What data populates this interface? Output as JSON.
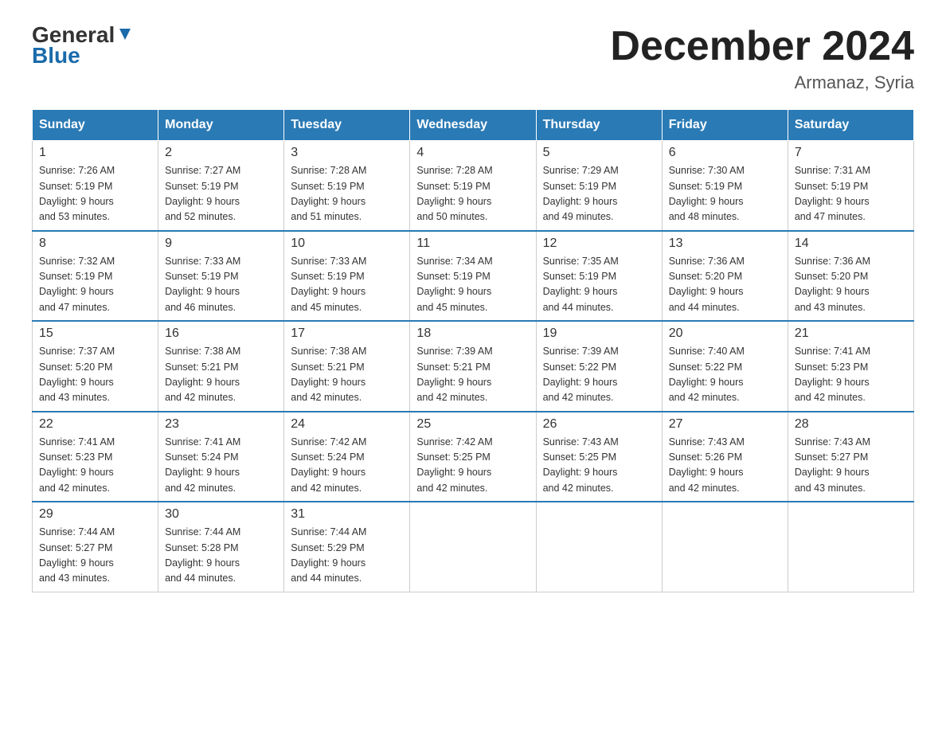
{
  "logo": {
    "line1": "General",
    "line2": "Blue"
  },
  "title": "December 2024",
  "subtitle": "Armanaz, Syria",
  "weekdays": [
    "Sunday",
    "Monday",
    "Tuesday",
    "Wednesday",
    "Thursday",
    "Friday",
    "Saturday"
  ],
  "weeks": [
    [
      {
        "day": "1",
        "sunrise": "7:26 AM",
        "sunset": "5:19 PM",
        "daylight": "9 hours and 53 minutes."
      },
      {
        "day": "2",
        "sunrise": "7:27 AM",
        "sunset": "5:19 PM",
        "daylight": "9 hours and 52 minutes."
      },
      {
        "day": "3",
        "sunrise": "7:28 AM",
        "sunset": "5:19 PM",
        "daylight": "9 hours and 51 minutes."
      },
      {
        "day": "4",
        "sunrise": "7:28 AM",
        "sunset": "5:19 PM",
        "daylight": "9 hours and 50 minutes."
      },
      {
        "day": "5",
        "sunrise": "7:29 AM",
        "sunset": "5:19 PM",
        "daylight": "9 hours and 49 minutes."
      },
      {
        "day": "6",
        "sunrise": "7:30 AM",
        "sunset": "5:19 PM",
        "daylight": "9 hours and 48 minutes."
      },
      {
        "day": "7",
        "sunrise": "7:31 AM",
        "sunset": "5:19 PM",
        "daylight": "9 hours and 47 minutes."
      }
    ],
    [
      {
        "day": "8",
        "sunrise": "7:32 AM",
        "sunset": "5:19 PM",
        "daylight": "9 hours and 47 minutes."
      },
      {
        "day": "9",
        "sunrise": "7:33 AM",
        "sunset": "5:19 PM",
        "daylight": "9 hours and 46 minutes."
      },
      {
        "day": "10",
        "sunrise": "7:33 AM",
        "sunset": "5:19 PM",
        "daylight": "9 hours and 45 minutes."
      },
      {
        "day": "11",
        "sunrise": "7:34 AM",
        "sunset": "5:19 PM",
        "daylight": "9 hours and 45 minutes."
      },
      {
        "day": "12",
        "sunrise": "7:35 AM",
        "sunset": "5:19 PM",
        "daylight": "9 hours and 44 minutes."
      },
      {
        "day": "13",
        "sunrise": "7:36 AM",
        "sunset": "5:20 PM",
        "daylight": "9 hours and 44 minutes."
      },
      {
        "day": "14",
        "sunrise": "7:36 AM",
        "sunset": "5:20 PM",
        "daylight": "9 hours and 43 minutes."
      }
    ],
    [
      {
        "day": "15",
        "sunrise": "7:37 AM",
        "sunset": "5:20 PM",
        "daylight": "9 hours and 43 minutes."
      },
      {
        "day": "16",
        "sunrise": "7:38 AM",
        "sunset": "5:21 PM",
        "daylight": "9 hours and 42 minutes."
      },
      {
        "day": "17",
        "sunrise": "7:38 AM",
        "sunset": "5:21 PM",
        "daylight": "9 hours and 42 minutes."
      },
      {
        "day": "18",
        "sunrise": "7:39 AM",
        "sunset": "5:21 PM",
        "daylight": "9 hours and 42 minutes."
      },
      {
        "day": "19",
        "sunrise": "7:39 AM",
        "sunset": "5:22 PM",
        "daylight": "9 hours and 42 minutes."
      },
      {
        "day": "20",
        "sunrise": "7:40 AM",
        "sunset": "5:22 PM",
        "daylight": "9 hours and 42 minutes."
      },
      {
        "day": "21",
        "sunrise": "7:41 AM",
        "sunset": "5:23 PM",
        "daylight": "9 hours and 42 minutes."
      }
    ],
    [
      {
        "day": "22",
        "sunrise": "7:41 AM",
        "sunset": "5:23 PM",
        "daylight": "9 hours and 42 minutes."
      },
      {
        "day": "23",
        "sunrise": "7:41 AM",
        "sunset": "5:24 PM",
        "daylight": "9 hours and 42 minutes."
      },
      {
        "day": "24",
        "sunrise": "7:42 AM",
        "sunset": "5:24 PM",
        "daylight": "9 hours and 42 minutes."
      },
      {
        "day": "25",
        "sunrise": "7:42 AM",
        "sunset": "5:25 PM",
        "daylight": "9 hours and 42 minutes."
      },
      {
        "day": "26",
        "sunrise": "7:43 AM",
        "sunset": "5:25 PM",
        "daylight": "9 hours and 42 minutes."
      },
      {
        "day": "27",
        "sunrise": "7:43 AM",
        "sunset": "5:26 PM",
        "daylight": "9 hours and 42 minutes."
      },
      {
        "day": "28",
        "sunrise": "7:43 AM",
        "sunset": "5:27 PM",
        "daylight": "9 hours and 43 minutes."
      }
    ],
    [
      {
        "day": "29",
        "sunrise": "7:44 AM",
        "sunset": "5:27 PM",
        "daylight": "9 hours and 43 minutes."
      },
      {
        "day": "30",
        "sunrise": "7:44 AM",
        "sunset": "5:28 PM",
        "daylight": "9 hours and 44 minutes."
      },
      {
        "day": "31",
        "sunrise": "7:44 AM",
        "sunset": "5:29 PM",
        "daylight": "9 hours and 44 minutes."
      },
      null,
      null,
      null,
      null
    ]
  ],
  "labels": {
    "sunrise": "Sunrise:",
    "sunset": "Sunset:",
    "daylight": "Daylight:"
  }
}
